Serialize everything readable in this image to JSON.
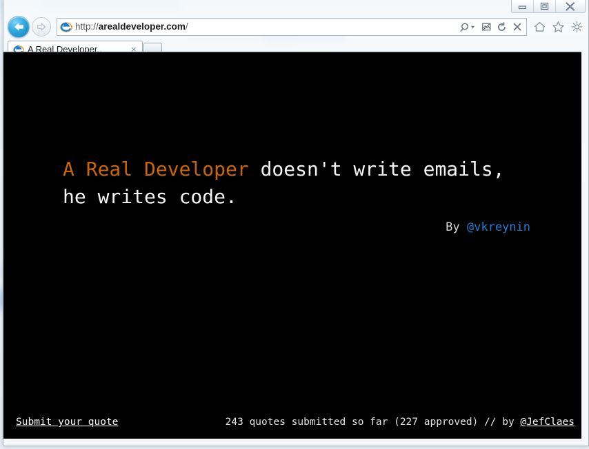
{
  "window": {
    "controls": [
      {
        "name": "minimize",
        "label": "Minimize"
      },
      {
        "name": "restore",
        "label": "Restore Down"
      },
      {
        "name": "close",
        "label": "Close"
      }
    ]
  },
  "navigation": {
    "back_label": "Back",
    "forward_label": "Forward",
    "address": {
      "scheme_prefix": "http://",
      "host": "arealdeveloper.com",
      "path": "/",
      "full_url": "http://arealdeveloper.com/",
      "placeholder": "http://arealdeveloper.com/",
      "favicon": "ie-logo-icon"
    },
    "address_buttons": [
      {
        "name": "search-icon",
        "glyph": "search"
      },
      {
        "name": "search-dropdown-icon",
        "glyph": "chevron-down"
      },
      {
        "name": "compatibility-view-icon",
        "glyph": "compat"
      },
      {
        "name": "refresh-icon",
        "glyph": "refresh"
      },
      {
        "name": "stop-icon",
        "glyph": "close-x"
      }
    ],
    "command_buttons": [
      {
        "name": "home-icon",
        "label": "Home"
      },
      {
        "name": "favorites-icon",
        "label": "Favorites"
      },
      {
        "name": "tools-icon",
        "label": "Tools"
      }
    ]
  },
  "tabs": {
    "items": [
      {
        "title": "A Real Developer..",
        "favicon": "ie-logo-icon",
        "close_label": "×",
        "active": true
      }
    ],
    "new_tab_label": ""
  },
  "page": {
    "quote": {
      "highlight": "A Real Developer",
      "rest": " doesn't write emails, he writes code.",
      "byline_prefix": "By ",
      "byline_handle": "@vkreynin"
    },
    "footer": {
      "submit_link": "Submit your quote",
      "stats_text": "243 quotes submitted so far (227 approved) // by ",
      "credit_handle": "@JefClaes"
    }
  },
  "colors": {
    "page_background": "#000000",
    "quote_text": "#f4f4f4",
    "quote_highlight": "#cc6600",
    "link_blue": "#1a7fd4",
    "footer_text": "#e4e4e4"
  }
}
